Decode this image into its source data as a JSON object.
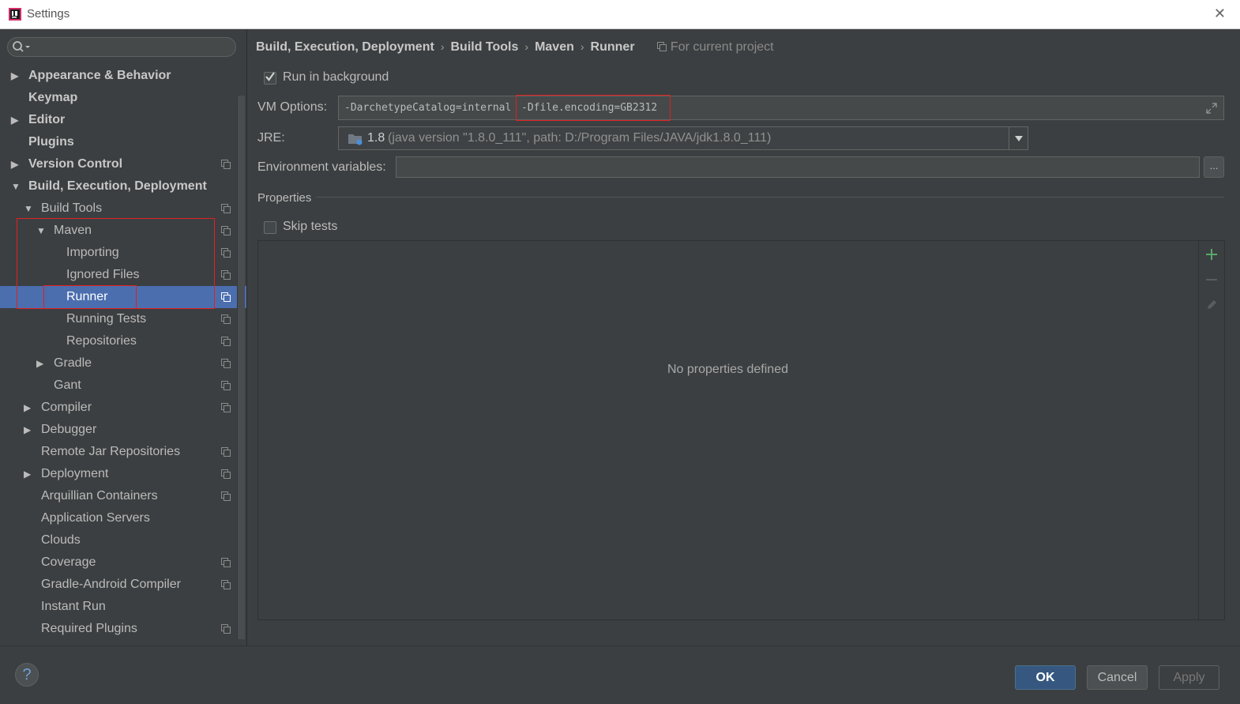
{
  "window": {
    "title": "Settings"
  },
  "search": {
    "placeholder": ""
  },
  "tree": {
    "items": [
      {
        "label": "Appearance & Behavior",
        "level": 0,
        "arrow": "▶",
        "bold": true,
        "proj": false,
        "selected": false
      },
      {
        "label": "Keymap",
        "level": 0,
        "arrow": "",
        "bold": true,
        "proj": false,
        "selected": false
      },
      {
        "label": "Editor",
        "level": 0,
        "arrow": "▶",
        "bold": true,
        "proj": false,
        "selected": false
      },
      {
        "label": "Plugins",
        "level": 0,
        "arrow": "",
        "bold": true,
        "proj": false,
        "selected": false
      },
      {
        "label": "Version Control",
        "level": 0,
        "arrow": "▶",
        "bold": true,
        "proj": true,
        "selected": false
      },
      {
        "label": "Build, Execution, Deployment",
        "level": 0,
        "arrow": "▼",
        "bold": true,
        "proj": false,
        "selected": false
      },
      {
        "label": "Build Tools",
        "level": 1,
        "arrow": "▼",
        "bold": false,
        "proj": true,
        "selected": false
      },
      {
        "label": "Maven",
        "level": 2,
        "arrow": "▼",
        "bold": false,
        "proj": true,
        "selected": false
      },
      {
        "label": "Importing",
        "level": 3,
        "arrow": "",
        "bold": false,
        "proj": true,
        "selected": false
      },
      {
        "label": "Ignored Files",
        "level": 3,
        "arrow": "",
        "bold": false,
        "proj": true,
        "selected": false
      },
      {
        "label": "Runner",
        "level": 3,
        "arrow": "",
        "bold": false,
        "proj": true,
        "selected": true
      },
      {
        "label": "Running Tests",
        "level": 3,
        "arrow": "",
        "bold": false,
        "proj": true,
        "selected": false
      },
      {
        "label": "Repositories",
        "level": 3,
        "arrow": "",
        "bold": false,
        "proj": true,
        "selected": false
      },
      {
        "label": "Gradle",
        "level": 2,
        "arrow": "▶",
        "bold": false,
        "proj": true,
        "selected": false
      },
      {
        "label": "Gant",
        "level": 2,
        "arrow": "",
        "bold": false,
        "proj": true,
        "selected": false
      },
      {
        "label": "Compiler",
        "level": 1,
        "arrow": "▶",
        "bold": false,
        "proj": true,
        "selected": false
      },
      {
        "label": "Debugger",
        "level": 1,
        "arrow": "▶",
        "bold": false,
        "proj": false,
        "selected": false
      },
      {
        "label": "Remote Jar Repositories",
        "level": 1,
        "arrow": "",
        "bold": false,
        "proj": true,
        "selected": false
      },
      {
        "label": "Deployment",
        "level": 1,
        "arrow": "▶",
        "bold": false,
        "proj": true,
        "selected": false
      },
      {
        "label": "Arquillian Containers",
        "level": 1,
        "arrow": "",
        "bold": false,
        "proj": true,
        "selected": false
      },
      {
        "label": "Application Servers",
        "level": 1,
        "arrow": "",
        "bold": false,
        "proj": false,
        "selected": false
      },
      {
        "label": "Clouds",
        "level": 1,
        "arrow": "",
        "bold": false,
        "proj": false,
        "selected": false
      },
      {
        "label": "Coverage",
        "level": 1,
        "arrow": "",
        "bold": false,
        "proj": true,
        "selected": false
      },
      {
        "label": "Gradle-Android Compiler",
        "level": 1,
        "arrow": "",
        "bold": false,
        "proj": true,
        "selected": false
      },
      {
        "label": "Instant Run",
        "level": 1,
        "arrow": "",
        "bold": false,
        "proj": false,
        "selected": false
      },
      {
        "label": "Required Plugins",
        "level": 1,
        "arrow": "",
        "bold": false,
        "proj": true,
        "selected": false
      }
    ]
  },
  "breadcrumb": {
    "items": [
      "Build, Execution, Deployment",
      "Build Tools",
      "Maven",
      "Runner"
    ],
    "separator": "›",
    "scope": "For current project"
  },
  "runner": {
    "run_in_background": {
      "label": "Run in background",
      "checked": true
    },
    "vm_options": {
      "label": "VM Options:",
      "value_part1": "-DarchetypeCatalog=internal",
      "value_part2": "-Dfile.encoding=GB2312"
    },
    "jre": {
      "label": "JRE:",
      "version": "1.8",
      "detail": "(java version \"1.8.0_111\", path: D:/Program Files/JAVA/jdk1.8.0_111)"
    },
    "env": {
      "label": "Environment variables:",
      "value": "",
      "browse": "..."
    },
    "properties": {
      "title": "Properties",
      "skip_tests": {
        "label": "Skip tests",
        "checked": false
      },
      "empty_text": "No properties defined"
    }
  },
  "footer": {
    "help": "?",
    "ok": "OK",
    "cancel": "Cancel",
    "apply": "Apply"
  },
  "colors": {
    "background": "#3c3f41",
    "selection": "#4b6eaf",
    "highlight_box": "#e02020",
    "add_icon": "#59a869"
  }
}
